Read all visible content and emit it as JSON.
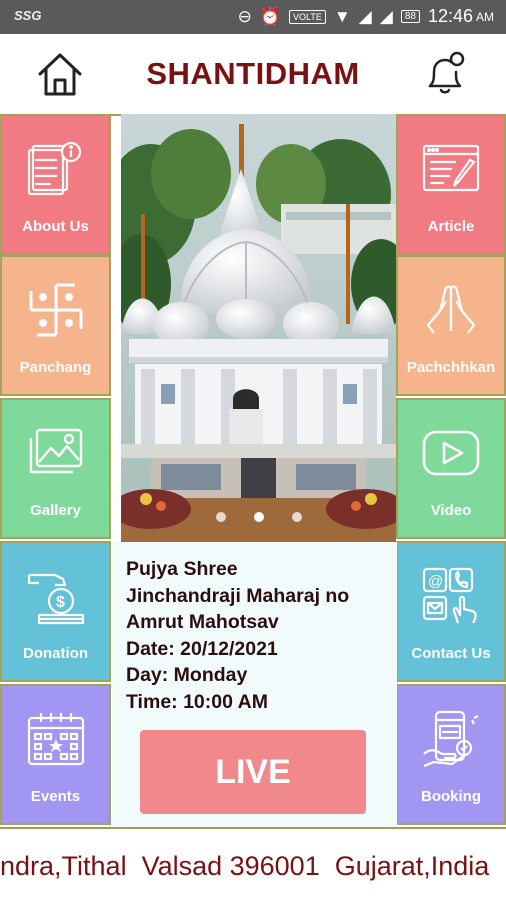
{
  "status_bar": {
    "carrier": "SSG",
    "network": "VOLTE",
    "battery": "88",
    "time": "12:46",
    "ampm": "AM"
  },
  "header": {
    "title": "SHANTIDHAM"
  },
  "left_tiles": [
    {
      "label": "About Us",
      "icon": "document-info-icon",
      "color": "#f27a82"
    },
    {
      "label": "Panchang",
      "icon": "swastika-icon",
      "color": "#f5b48c"
    },
    {
      "label": "Gallery",
      "icon": "image-gallery-icon",
      "color": "#7ed99a"
    },
    {
      "label": "Donation",
      "icon": "donation-hand-icon",
      "color": "#63c1d8"
    },
    {
      "label": "Events",
      "icon": "calendar-icon",
      "color": "#a196f2"
    }
  ],
  "right_tiles": [
    {
      "label": "Article",
      "icon": "article-edit-icon",
      "color": "#f27a82"
    },
    {
      "label": "Pachchhkan",
      "icon": "praying-hands-icon",
      "color": "#f5b48c"
    },
    {
      "label": "Video",
      "icon": "play-video-icon",
      "color": "#7ed99a"
    },
    {
      "label": "Contact Us",
      "icon": "contact-icon",
      "color": "#63c1d8"
    },
    {
      "label": "Booking",
      "icon": "booking-icon",
      "color": "#a196f2"
    }
  ],
  "banner": {
    "image": "temple-photo",
    "slides": 3,
    "active_slide": 2
  },
  "event": {
    "line1": "Pujya Shree",
    "line2": "Jinchandraji Maharaj no",
    "line3": "Amrut Mahotsav",
    "date": "Date: 20/12/2021",
    "day": "Day: Monday",
    "time": "Time: 10:00 AM",
    "live_label": "LIVE"
  },
  "footer": {
    "marquee": "ndra,Tithal  Valsad 396001  Gujarat,India"
  }
}
